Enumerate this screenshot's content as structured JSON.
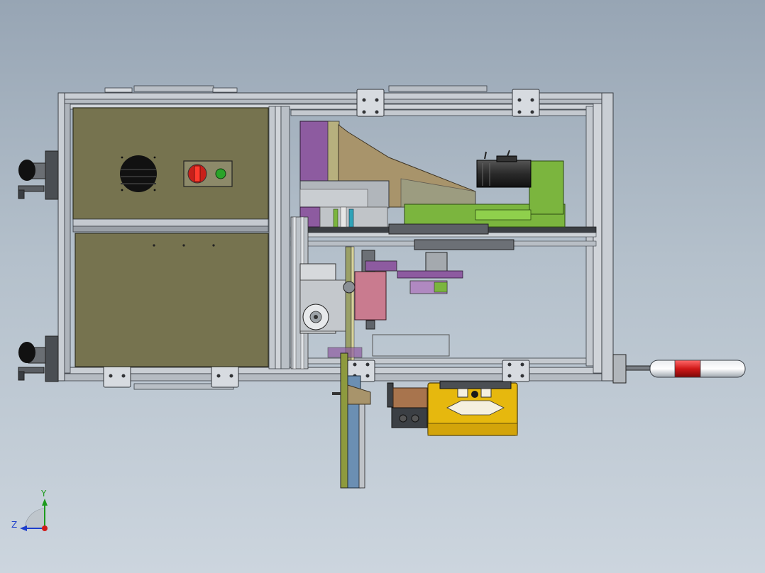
{
  "triad": {
    "y_label": "Y",
    "z_label": "Z"
  },
  "colors": {
    "frame": "#c7ccd2",
    "cabinet": "#76734f",
    "stop_button": "#c8201a",
    "indicator": "#29a329",
    "gantry": "#7bb53e",
    "base_plate": "#a8946b",
    "bracket": "#8d5ba0",
    "fixture_block": "#c97b8f",
    "tray": "#e6b80e",
    "tower_light_red": "#d01818",
    "axis_y": "#1d9a1d",
    "axis_z": "#1e3fcc",
    "axis_x": "#d11a1a"
  },
  "icons": {
    "stop_button": "red-rotary-switch-icon",
    "indicator_lamp": "green-pilot-lamp-icon",
    "fan": "fan-vent-icon",
    "servo_motor": "servo-motor-icon",
    "casters": "caster-wheel-icon",
    "signal_tower": "tower-light-icon"
  }
}
